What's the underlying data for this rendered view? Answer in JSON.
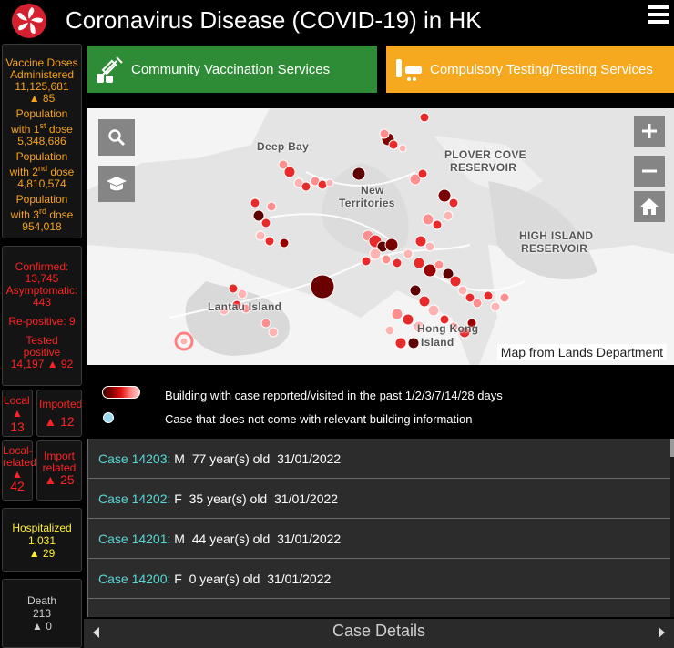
{
  "header": {
    "title": "Coronavirus Disease (COVID-19) in HK",
    "logo_icon": "hksar-bauhinia-icon",
    "menu_icon": "hamburger-menu-icon"
  },
  "vaccination": {
    "doses_label_1": "Vaccine Doses",
    "doses_label_2": "Administered",
    "doses_value": "11,125,681",
    "doses_change": "▲ 85",
    "first_label_1": "Population",
    "first_label_2a": "with 1",
    "first_label_2sup": "st",
    "first_label_2b": " dose",
    "first_value": "5,348,686",
    "second_label_1": "Population",
    "second_label_2a": "with 2",
    "second_label_2sup": "nd",
    "second_label_2b": " dose",
    "second_value": "4,810,574",
    "third_label_1": "Population",
    "third_label_2a": "with 3",
    "third_label_2sup": "rd",
    "third_label_2b": " dose",
    "third_value": "954,018"
  },
  "cases": {
    "confirmed_label": "Confirmed:",
    "confirmed_value": "13,745",
    "asymptomatic_label": "Asymptomatic:",
    "asymptomatic_value": "443",
    "repositive": "Re-positive:  9",
    "tested_label_1": "Tested",
    "tested_label_2": "positive",
    "tested_value": "14,197 ▲ 92"
  },
  "local": {
    "label": "Local",
    "arrow": "▲",
    "value": "13"
  },
  "imported": {
    "label": "Imported",
    "value": "▲ 12"
  },
  "local_related": {
    "label_1": "Local-",
    "label_2": "related",
    "arrow": "▲",
    "value": "42"
  },
  "import_related": {
    "label_1": "Import",
    "label_2": "related",
    "value": "▲ 25"
  },
  "hospitalized": {
    "label": "Hospitalized",
    "value": "1,031",
    "change": "▲ 29"
  },
  "death": {
    "label": "Death",
    "value": "213",
    "change": "▲ 0"
  },
  "services": {
    "vaccination": "Community Vaccination Services",
    "testing": "Compulsory Testing/Testing Services"
  },
  "map": {
    "labels": {
      "deep_bay": "Deep Bay",
      "new_territories_1": "New",
      "new_territories_2": "Territories",
      "plover_1": "PLOVER COVE",
      "plover_2": "RESERVOIR",
      "high_island_1": "HIGH ISLAND",
      "high_island_2": "RESERVOIR",
      "lantau": "Lantau Island",
      "hk_island_1": "Hong Kong",
      "hk_island_2": "Island"
    },
    "attribution": "Map from Lands Department",
    "buttons": {
      "search_icon": "search-icon",
      "basemap_icon": "graduation-cap-icon",
      "zoom_in_icon": "plus-icon",
      "zoom_out_icon": "minus-icon",
      "home_icon": "home-icon"
    }
  },
  "legend": {
    "building_text": "Building with case reported/visited in the past 1/2/3/7/14/28 days",
    "nobuilding_text": "Case that does not come with relevant building information"
  },
  "case_list": [
    {
      "number": "Case 14203:",
      "details": " M  77 year(s) old  31/01/2022"
    },
    {
      "number": "Case 14202:",
      "details": " F  35 year(s) old  31/01/2022"
    },
    {
      "number": "Case 14201:",
      "details": " M  44 year(s) old  31/01/2022"
    },
    {
      "number": "Case 14200:",
      "details": " F  0 year(s) old  31/01/2022"
    }
  ],
  "footer": {
    "title": "Case Details"
  },
  "colors": {
    "vaccination_orange": "#f7a21b",
    "cases_red": "#ff2222",
    "hospital_yellow": "#ffee33",
    "service_green": "#2f8c36",
    "service_orange": "#f6a81f",
    "case_number_cyan": "#5ad6d6"
  }
}
